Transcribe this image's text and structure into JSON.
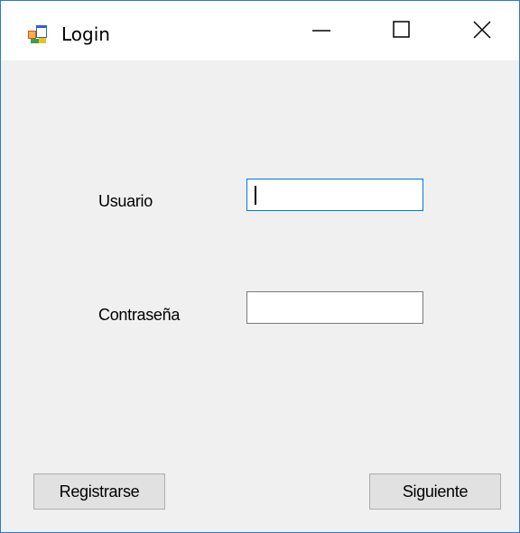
{
  "window": {
    "title": "Login",
    "icon": "winforms-app-icon",
    "controls": {
      "minimize": "minimize-icon",
      "maximize": "maximize-icon",
      "close": "close-icon"
    }
  },
  "form": {
    "user_label": "Usuario",
    "user_value": "",
    "password_label": "Contraseña",
    "password_value": ""
  },
  "buttons": {
    "register_label": "Registrarse",
    "next_label": "Siguiente"
  },
  "colors": {
    "accent": "#0078d7",
    "window_border": "#2b79d6",
    "client_bg": "#f0f0f0",
    "button_bg": "#e1e1e1"
  }
}
